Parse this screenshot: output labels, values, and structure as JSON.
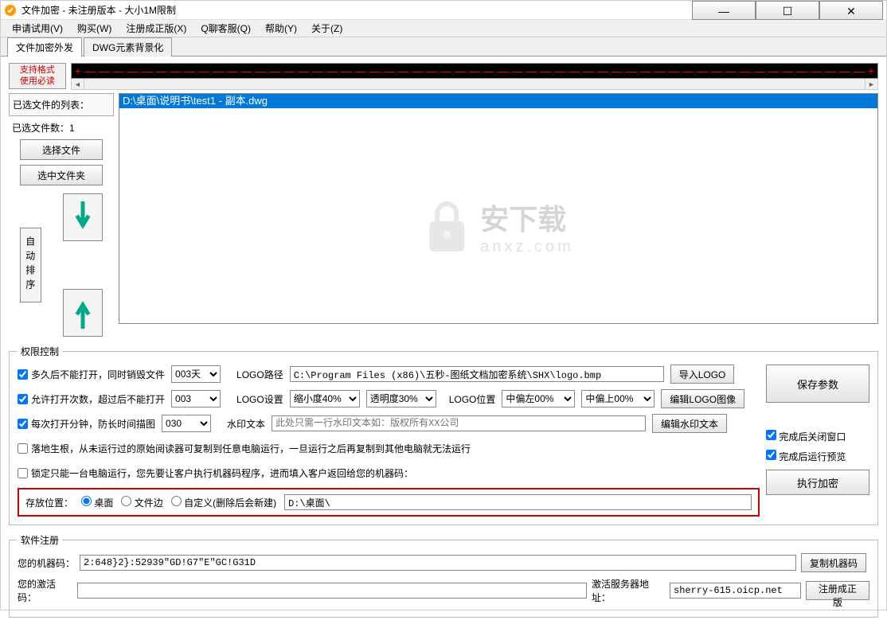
{
  "title": "文件加密 - 未注册版本 - 大小1M限制",
  "menu": [
    "申请试用(V)",
    "购买(W)",
    "注册成正版(X)",
    "Q聊客服(Q)",
    "帮助(Y)",
    "关于(Z)"
  ],
  "tabs": [
    "文件加密外发",
    "DWG元素背景化"
  ],
  "support_btn_l1": "支持格式",
  "support_btn_l2": "使用必读",
  "strip_text": "+ — — — — — — — — — — — — — — — — — — — — — — — — — — — — — — — — — — — — — — — — — — — — — — — — — — — — — — — +",
  "file_list_label": "已选文件的列表：",
  "file_count": "已选文件数：1",
  "select_file": "选择文件",
  "select_folder": "选中文件夹",
  "auto_sort": "自动排序",
  "selected_file": "D:\\桌面\\说明书\\test1 - 副本.dwg",
  "watermark_txt": "安下载",
  "watermark_sub": "anxz.com",
  "perm": {
    "legend": "权限控制",
    "opt1": "多久后不能打开，同时销毁文件",
    "days_opt": "003天",
    "logo_path_label": "LOGO路径",
    "logo_path": "C:\\Program Files (x86)\\五秒-图纸文档加密系统\\SHX\\logo.bmp",
    "import_logo": "导入LOGO",
    "opt2": "允许打开次数，超过后不能打开",
    "times_opt": "003",
    "logo_set_label": "LOGO设置",
    "scale_opt": "缩小度40%",
    "trans_opt": "透明度30%",
    "logo_pos_label": "LOGO位置",
    "pos_left": "中偏左00%",
    "pos_up": "中偏上00%",
    "edit_logo": "编辑LOGO图像",
    "opt3": "每次打开分钟，防长时间描图",
    "min_opt": "030",
    "wm_label": "水印文本",
    "wm_placeholder": "此处只需一行水印文本如：版权所有XX公司",
    "edit_wm": "编辑水印文本",
    "opt4": "落地生根，从未运行过的原始阅读器可复制到任意电脑运行，一旦运行之后再复制到其他电脑就无法运行",
    "opt5": "锁定只能一台电脑运行，您先要让客户执行机器码程序，进而填入客户返回给您的机器码：",
    "save_params": "保存参数",
    "chk_close": "完成后关闭窗口",
    "chk_preview": "完成后运行预览",
    "run_encrypt": "执行加密",
    "loc_label": "存放位置：",
    "loc_desktop": "桌面",
    "loc_fileedge": "文件边",
    "loc_custom": "自定义(删除后会新建)",
    "loc_path": "D:\\桌面\\"
  },
  "reg": {
    "legend": "软件注册",
    "machine_label": "您的机器码：",
    "machine_code": "2:648}2}:52939\"GD!G7\"E\"GC!G31D",
    "copy_btn": "复制机器码",
    "activate_label": "您的激活码：",
    "server_label": "激活服务器地址：",
    "server_val": "sherry-615.oicp.net",
    "reg_btn": "注册成正版"
  }
}
